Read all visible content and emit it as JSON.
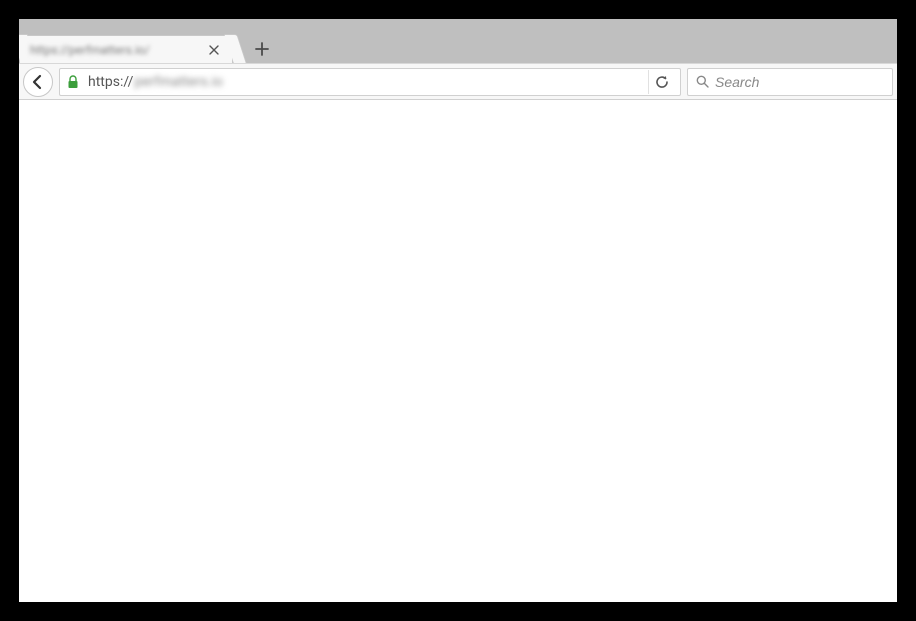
{
  "tab": {
    "title": "https://perfmatters.io/",
    "close_label": "Close tab"
  },
  "new_tab_label": "New tab",
  "toolbar": {
    "back_label": "Back",
    "reload_label": "Reload"
  },
  "address": {
    "scheme": "https://",
    "host_blurred": "perfmatters.io"
  },
  "search": {
    "placeholder": "Search",
    "value": ""
  }
}
